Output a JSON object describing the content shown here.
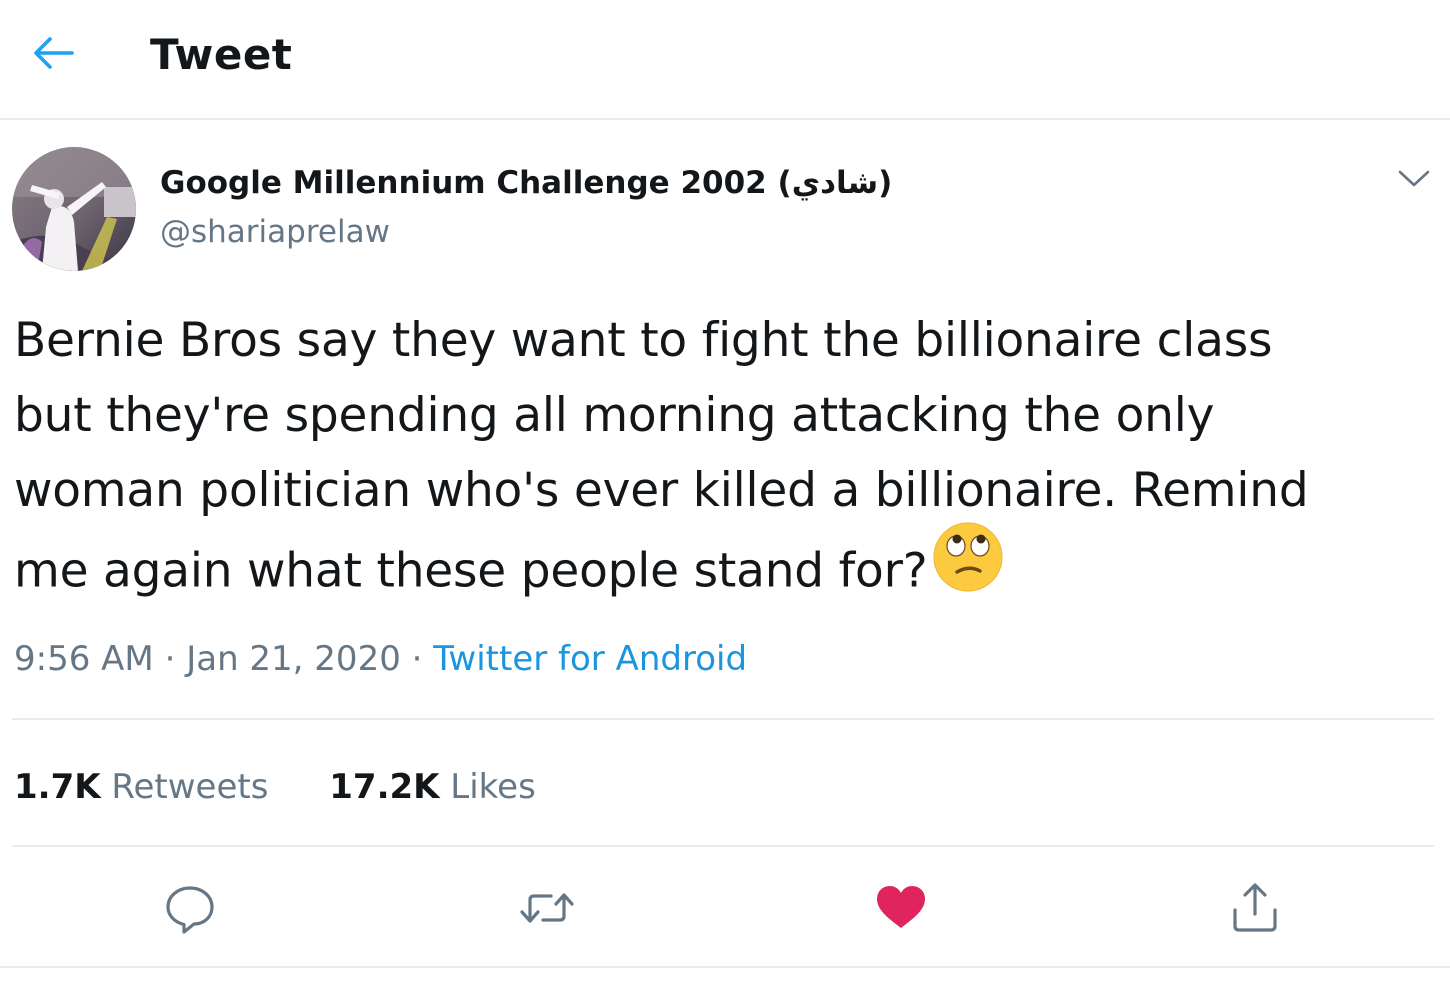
{
  "header": {
    "title": "Tweet",
    "back_icon": "arrow-left-icon"
  },
  "author": {
    "display_name": "Google Millennium Challenge 2002 (شادي)",
    "handle": "@shariaprelaw"
  },
  "tweet": {
    "lines": [
      "Bernie Bros say they want to fight the billionaire class",
      "but they're spending all morning attacking the only",
      "woman politician who's ever killed a billionaire. Remind",
      "me again what these people stand for?"
    ],
    "emoji": "face-with-rolling-eyes",
    "time": "9:56 AM",
    "separator": "·",
    "date": "Jan 21, 2020",
    "source": "Twitter for Android"
  },
  "stats": {
    "retweets_count": "1.7K",
    "retweets_label": "Retweets",
    "likes_count": "17.2K",
    "likes_label": "Likes"
  },
  "actions": {
    "reply_icon": "reply-icon",
    "retweet_icon": "retweet-icon",
    "like_icon": "heart-icon",
    "share_icon": "share-icon",
    "liked": true
  },
  "colors": {
    "accent": "#1da1f2",
    "link": "#1b95e0",
    "like": "#e0245e",
    "muted": "#657786",
    "text": "#14171a",
    "border": "#e6ecf0"
  }
}
